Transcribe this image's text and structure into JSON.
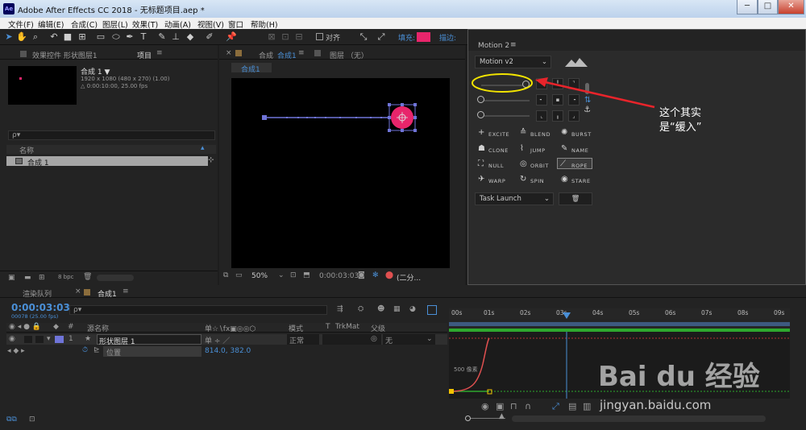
{
  "window": {
    "app_icon": "Ae",
    "title": "Adobe After Effects CC 2018 - 无标题项目.aep *",
    "min": "─",
    "max": "□",
    "close": "✕"
  },
  "menu": [
    "文件(F)",
    "编辑(E)",
    "合成(C)",
    "图层(L)",
    "效果(T)",
    "动画(A)",
    "视图(V)",
    "窗口",
    "帮助(H)"
  ],
  "toolbar": {
    "align_label": "对齐",
    "fill_label": "填充:",
    "stroke_label": "描边:",
    "fill_color": "#e8256b"
  },
  "project_panel": {
    "tab_effects": "效果控件 形状图层1",
    "tab_project": "项目",
    "comp_name": "合成 1 ▼",
    "comp_info1": "1920 x 1080 (480 x 270) (1.00)",
    "comp_info2": "△ 0:00:10:00, 25.00 fps",
    "search_placeholder": "ρ▾",
    "col_name": "名称",
    "item_name": "合成 1",
    "bpc": "8 bpc"
  },
  "comp_panel": {
    "tab_comp_prefix": "合成",
    "tab_comp_name": "合成1",
    "tab_layer": "图层 （无）",
    "breadcrumb": "合成1",
    "zoom": "50%",
    "timecode": "0:00:03:03",
    "quality": "(二分..."
  },
  "motion_panel": {
    "title": "Motion 2",
    "version": "Motion v2",
    "features": [
      {
        "icon": "+",
        "label": "EXCITE"
      },
      {
        "icon": "≙",
        "label": "BLEND"
      },
      {
        "icon": "✺",
        "label": "BURST"
      },
      {
        "icon": "☗",
        "label": "CLONE"
      },
      {
        "icon": "⌇",
        "label": "JUMP"
      },
      {
        "icon": "✎",
        "label": "NAME"
      },
      {
        "icon": "⛶",
        "label": "NULL"
      },
      {
        "icon": "◎",
        "label": "ORBIT"
      },
      {
        "icon": "⟋",
        "label": "ROPE"
      },
      {
        "icon": "✈",
        "label": "WARP"
      },
      {
        "icon": "↻",
        "label": "SPIN"
      },
      {
        "icon": "◉",
        "label": "STARE"
      }
    ],
    "task": "Task Launch",
    "trash": "🗑"
  },
  "annotation": {
    "line1": "这个其实",
    "line2": "是“缓入”"
  },
  "timeline": {
    "tab_render": "渲染队列",
    "tab_comp": "合成1",
    "timecode": "0:00:03:03",
    "frames": "00078 (25.00 fps)",
    "col_num": "#",
    "col_source": "源名称",
    "col_mode": "模式",
    "col_t": "T",
    "col_trkmat": "TrkMat",
    "col_parent": "父级",
    "layer_num": "1",
    "layer_name": "形状图层 1",
    "layer_mode": "正常",
    "layer_parent": "无",
    "prop_name": "位置",
    "prop_value": "814.0, 382.0",
    "graph_label": "500 像素",
    "ticks": [
      "00s",
      "01s",
      "02s",
      "03s",
      "04s",
      "05s",
      "06s",
      "07s",
      "08s",
      "09s"
    ]
  },
  "watermark": {
    "brand": "Bai du 经验",
    "url": "jingyan.baidu.com"
  }
}
